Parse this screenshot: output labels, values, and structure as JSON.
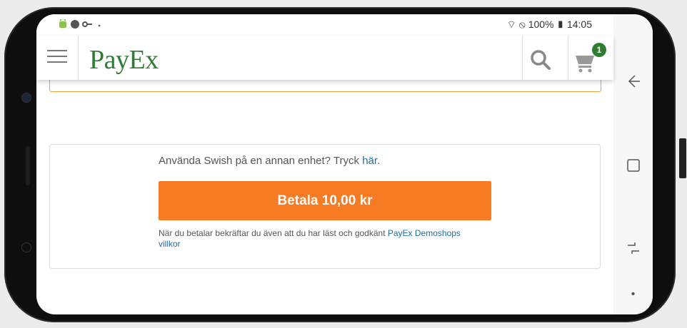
{
  "status_bar": {
    "left_icons": "• ◐ ∥ ·",
    "right_text": "◠⃠ 100% ▮ 14:05",
    "battery": "100%",
    "time": "14:05"
  },
  "app_bar": {
    "logo_text": "PayEx",
    "cart_count": "1"
  },
  "payment": {
    "swish_question": "Använda Swish på en annan enhet? Tryck",
    "swish_link": "här",
    "swish_period": ".",
    "pay_button": "Betala 10,00 kr",
    "terms_text": "När du betalar bekräftar du även att du har läst och godkänt",
    "terms_link": "PayEx Demoshops villkor"
  },
  "colors": {
    "brand": "#2e7d32",
    "pay_button": "#f77b25",
    "link": "#1b6ea8"
  },
  "icons": [
    "menu-icon",
    "search-icon",
    "cart-icon",
    "back-icon",
    "recents-icon",
    "home-icon",
    "dot-icon"
  ]
}
